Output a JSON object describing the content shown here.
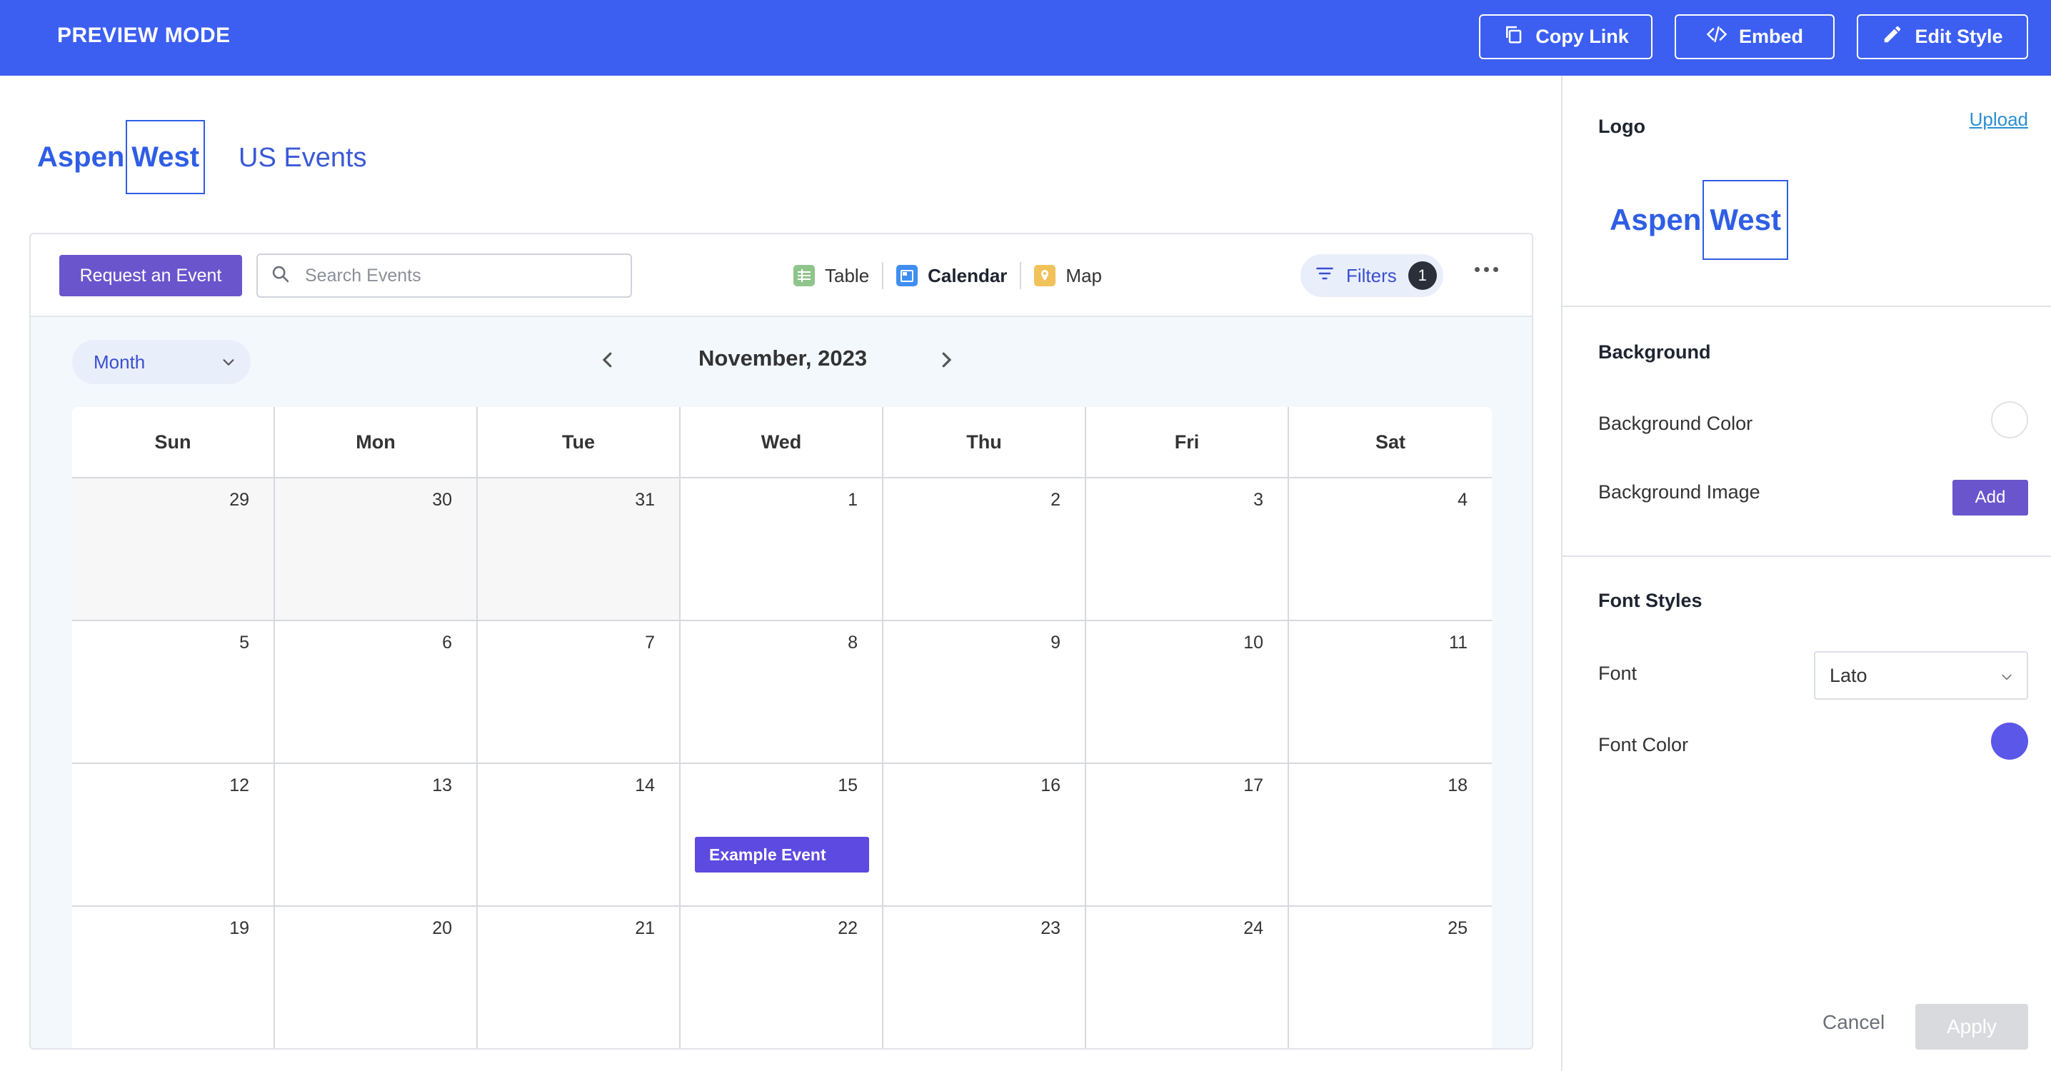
{
  "topbar": {
    "mode_label": "PREVIEW MODE",
    "copy_link_label": "Copy Link",
    "embed_label": "Embed",
    "edit_style_label": "Edit Style",
    "background_color": "#3c5ff2"
  },
  "brand": {
    "logo_part1": "Aspen",
    "logo_part2": "West",
    "title": "US Events"
  },
  "toolbar": {
    "request_label": "Request an Event",
    "search_placeholder": "Search Events",
    "views": [
      {
        "label": "Table",
        "icon": "table-icon",
        "active": false
      },
      {
        "label": "Calendar",
        "icon": "calendar-icon",
        "active": true
      },
      {
        "label": "Map",
        "icon": "map-pin-icon",
        "active": false
      }
    ],
    "filters_label": "Filters",
    "filters_count": "1"
  },
  "calendar": {
    "view_mode": "Month",
    "month_title": "November, 2023",
    "weekdays": [
      "Sun",
      "Mon",
      "Tue",
      "Wed",
      "Thu",
      "Fri",
      "Sat"
    ],
    "days": [
      {
        "num": "29",
        "other": true
      },
      {
        "num": "30",
        "other": true
      },
      {
        "num": "31",
        "other": true
      },
      {
        "num": "1"
      },
      {
        "num": "2"
      },
      {
        "num": "3"
      },
      {
        "num": "4"
      },
      {
        "num": "5"
      },
      {
        "num": "6"
      },
      {
        "num": "7"
      },
      {
        "num": "8"
      },
      {
        "num": "9"
      },
      {
        "num": "10"
      },
      {
        "num": "11"
      },
      {
        "num": "12"
      },
      {
        "num": "13"
      },
      {
        "num": "14"
      },
      {
        "num": "15",
        "event": "Example Event"
      },
      {
        "num": "16"
      },
      {
        "num": "17"
      },
      {
        "num": "18"
      },
      {
        "num": "19"
      },
      {
        "num": "20"
      },
      {
        "num": "21"
      },
      {
        "num": "22"
      },
      {
        "num": "23"
      },
      {
        "num": "24"
      },
      {
        "num": "25"
      }
    ],
    "event_color": "#5d4ae0"
  },
  "panel": {
    "logo_title": "Logo",
    "upload_label": "Upload",
    "background_title": "Background",
    "background_color_label": "Background Color",
    "background_color_value": "#ffffff",
    "background_image_label": "Background Image",
    "add_label": "Add",
    "font_styles_title": "Font Styles",
    "font_label": "Font",
    "font_value": "Lato",
    "font_color_label": "Font Color",
    "font_color_value": "#5b57e8",
    "cancel_label": "Cancel",
    "apply_label": "Apply"
  }
}
